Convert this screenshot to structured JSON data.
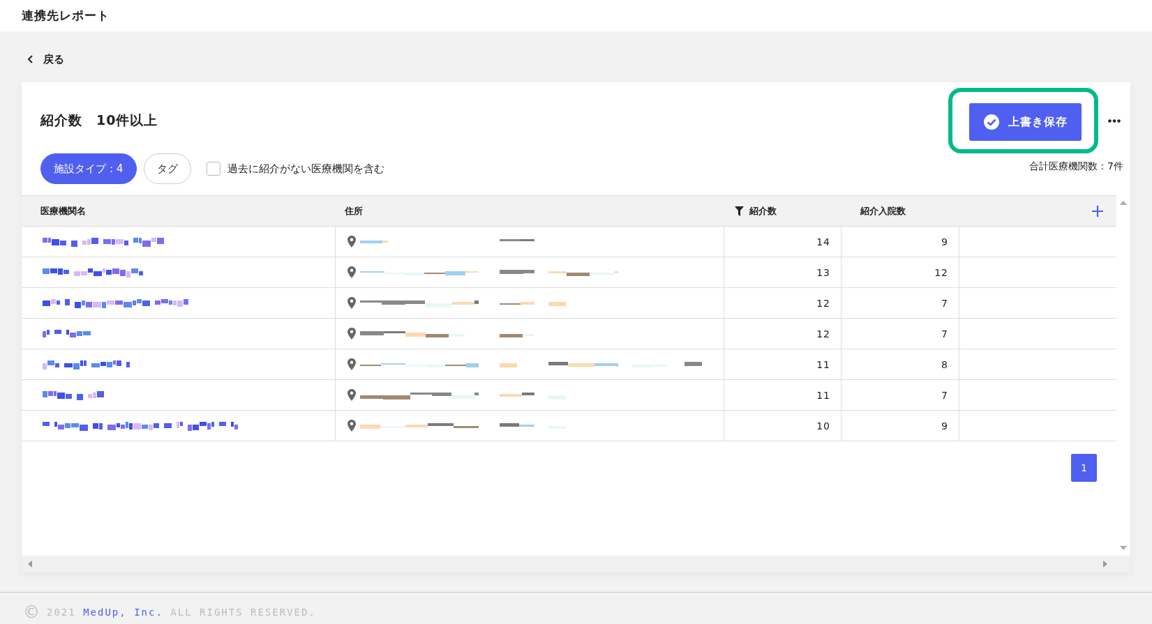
{
  "header": {
    "title": "連携先レポート"
  },
  "back_link": {
    "label": "戻る"
  },
  "report": {
    "title": "紹介数　10件以上",
    "save_button": "上書き保存",
    "total": "合計医療機関数：7件"
  },
  "filters": [
    {
      "label": "施設タイプ：4",
      "selected": true
    },
    {
      "label": "タグ",
      "selected": false
    }
  ],
  "include_no_referral": {
    "label": "過去に紹介がない医療機関を含む",
    "checked": false
  },
  "table": {
    "columns": [
      "医療機関名",
      "住所",
      "紹介数",
      "紹介入院数"
    ],
    "rows": [
      {
        "referrals": "14",
        "admissions": "9"
      },
      {
        "referrals": "13",
        "admissions": "12"
      },
      {
        "referrals": "12",
        "admissions": "7"
      },
      {
        "referrals": "12",
        "admissions": "7"
      },
      {
        "referrals": "11",
        "admissions": "8"
      },
      {
        "referrals": "11",
        "admissions": "7"
      },
      {
        "referrals": "10",
        "admissions": "9"
      }
    ]
  },
  "pagination": [
    {
      "label": "1",
      "selected": true
    }
  ],
  "footer": {
    "symbol": "©",
    "year": "2021",
    "company": "MedUp, Inc.",
    "rights": "ALL RIGHTS RESERVED."
  }
}
